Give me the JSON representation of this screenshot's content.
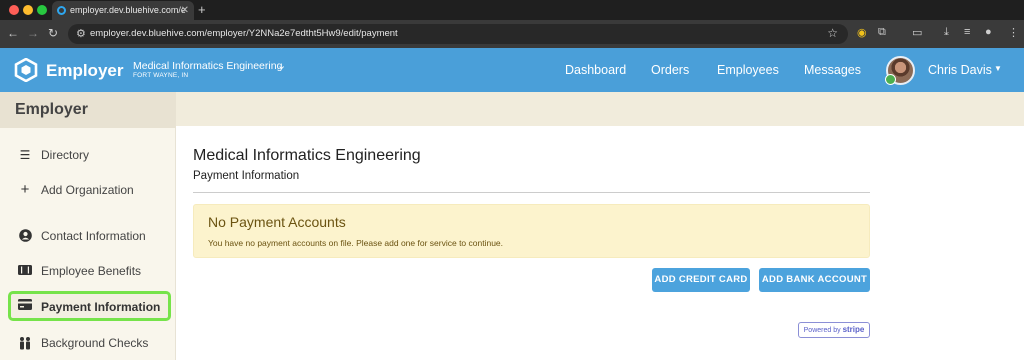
{
  "browser": {
    "tab_title": "employer.dev.bluehive.com/e",
    "url": "employer.dev.bluehive.com/employer/Y2NNa2e7edtht5Hw9/edit/payment"
  },
  "header": {
    "brand": "Employer",
    "org_name": "Medical Informatics Engineering",
    "org_location": "FORT WAYNE, IN",
    "nav": [
      "Dashboard",
      "Orders",
      "Employees",
      "Messages"
    ],
    "user_name": "Chris Davis",
    "brand_color": "#4a9fd9"
  },
  "sidebar": {
    "title": "Employer",
    "items": [
      {
        "label": "Directory",
        "icon": "list-icon",
        "active": false
      },
      {
        "label": "Add Organization",
        "icon": "plus-icon",
        "active": false
      },
      {
        "label": "Contact Information",
        "icon": "user-circle-icon",
        "active": false
      },
      {
        "label": "Employee Benefits",
        "icon": "ticket-icon",
        "active": false
      },
      {
        "label": "Payment Information",
        "icon": "credit-card-icon",
        "active": true
      },
      {
        "label": "Background Checks",
        "icon": "people-icon",
        "active": false
      }
    ]
  },
  "main": {
    "title": "Medical Informatics Engineering",
    "subtitle": "Payment Information",
    "alert": {
      "title": "No Payment Accounts",
      "text": "You have no payment accounts on file. Please add one for service to continue."
    },
    "buttons": {
      "add_credit_card": "ADD CREDIT CARD",
      "add_bank_account": "ADD BANK ACCOUNT"
    },
    "stripe_badge": {
      "prefix": "Powered by",
      "brand": "stripe"
    }
  }
}
